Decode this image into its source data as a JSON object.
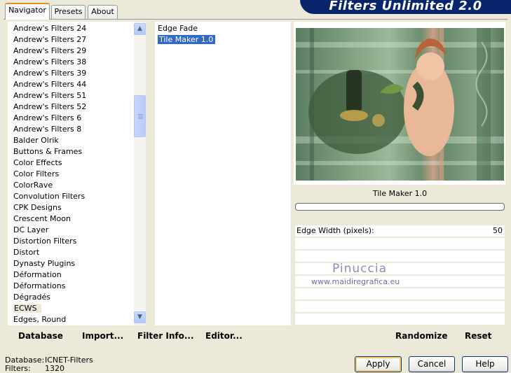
{
  "banner": {
    "title": "Filters Unlimited 2.0"
  },
  "tabs": [
    {
      "label": "Navigator",
      "active": true
    },
    {
      "label": "Presets",
      "active": false
    },
    {
      "label": "About",
      "active": false
    }
  ],
  "categories": {
    "items": [
      "Andrew's Filters 24",
      "Andrew's Filters 27",
      "Andrew's Filters 29",
      "Andrew's Filters 38",
      "Andrew's Filters 39",
      "Andrew's Filters 44",
      "Andrew's Filters 51",
      "Andrew's Filters 52",
      "Andrew's Filters 6",
      "Andrew's Filters 8",
      "Balder Olrik",
      "Buttons & Frames",
      "Color Effects",
      "Color Filters",
      "ColorRave",
      "Convolution Filters",
      "CPK Designs",
      "Crescent Moon",
      "DC Layer",
      "Distortion Filters",
      "Distort",
      "Dynasty Plugins",
      "Déformation",
      "Déformations",
      "Dégradés",
      "ECWS",
      "Edges, Round"
    ],
    "selected": "ECWS"
  },
  "filters": {
    "items": [
      "Edge Fade",
      "Tile Maker 1.0"
    ],
    "selected": "Tile Maker 1.0"
  },
  "preview": {
    "filter_name": "Tile Maker 1.0",
    "watermark_name": "Pinuccia",
    "watermark_url": "www.maidiregrafica.eu",
    "params": [
      {
        "label": "Edge Width (pixels):",
        "value": "50"
      }
    ]
  },
  "left_actions": {
    "database": "Database",
    "import": "Import...",
    "filter_info": "Filter Info...",
    "editor": "Editor..."
  },
  "right_actions": {
    "randomize": "Randomize",
    "reset": "Reset"
  },
  "dialog": {
    "apply": "Apply",
    "cancel": "Cancel",
    "help": "Help"
  },
  "status": {
    "database_label": "Database:",
    "database_value": "ICNET-Filters",
    "filters_label": "Filters:",
    "filters_value": "1320"
  },
  "colors": {
    "window_bg": "#ece9d8",
    "banner_bg": "#08246b",
    "selection": "#316ac5",
    "tab_accent": "#e68b2c"
  },
  "icons": {
    "scroll_up": "chevron-up-icon",
    "scroll_down": "chevron-down-icon"
  }
}
